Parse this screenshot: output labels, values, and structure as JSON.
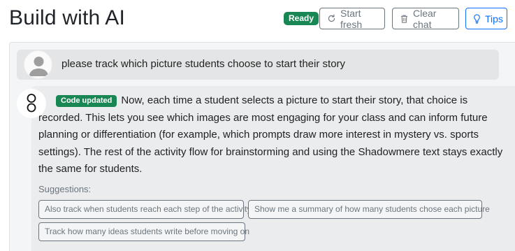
{
  "header": {
    "title": "Build with AI",
    "status_badge": "Ready",
    "start_fresh_label": "Start fresh",
    "clear_chat_label": "Clear chat",
    "tips_label": "Tips"
  },
  "chat": {
    "messages": [
      {
        "role": "user",
        "text": "please track which picture students choose to start their story"
      },
      {
        "role": "assistant",
        "badge": "Code updated",
        "text": "Now, each time a student selects a picture to start their story, that choice is recorded. This lets you see which images are most engaging for your class and can inform future planning or differentiation (for example, which prompts draw more interest in mystery vs. sports settings). The rest of the activity flow for brainstorming and using the Shadowmere text stays exactly the same for students."
      }
    ],
    "suggestions_label": "Suggestions:",
    "suggestions": [
      "Also track when students reach each step of the activity",
      "Show me a summary of how many students chose each picture",
      "Track how many ideas students write before moving on"
    ]
  },
  "colors": {
    "success": "#198754",
    "primary": "#0d6efd",
    "secondary": "#6c757d"
  },
  "icons": {
    "start_fresh": "refresh-icon",
    "clear_chat": "trash-icon",
    "tips": "lightbulb-icon",
    "user_avatar": "user-avatar-icon",
    "ai_avatar": "ai-logo-icon"
  }
}
